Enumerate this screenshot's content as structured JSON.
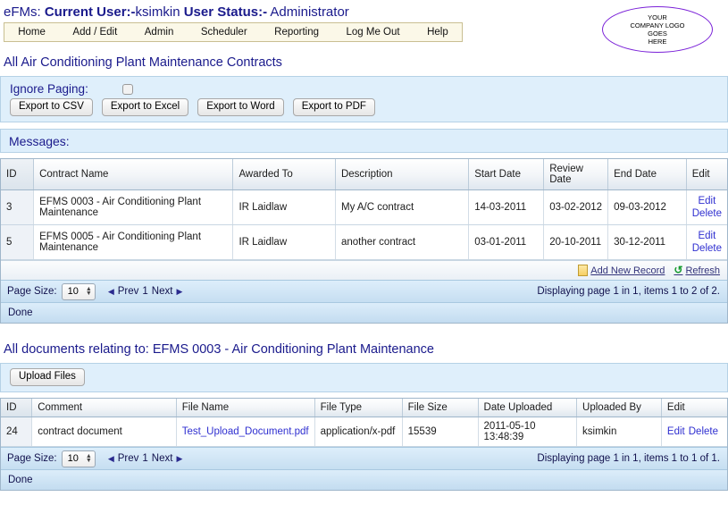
{
  "header": {
    "app_name": "eFMs:",
    "current_user_label": "Current User:-",
    "current_user": "ksimkin",
    "user_status_label": "User Status:-",
    "user_status": "Administrator",
    "nav": [
      {
        "label": "Home"
      },
      {
        "label": "Add / Edit"
      },
      {
        "label": "Admin"
      },
      {
        "label": "Scheduler"
      },
      {
        "label": "Reporting"
      },
      {
        "label": "Log Me Out"
      },
      {
        "label": "Help"
      }
    ],
    "logo": {
      "line1": "YOUR",
      "line2": "COMPANY LOGO",
      "line3": "GOES",
      "line4": "HERE",
      "color": "#7b22d8"
    }
  },
  "contracts_section": {
    "title": "All Air Conditioning Plant Maintenance Contracts",
    "toolbar": {
      "ignore_paging_label": "Ignore Paging:",
      "ignore_paging_checked": false,
      "export_csv": "Export to CSV",
      "export_excel": "Export to Excel",
      "export_word": "Export to Word",
      "export_pdf": "Export to PDF"
    },
    "messages_label": "Messages:",
    "messages_text": "",
    "columns": [
      "ID",
      "Contract Name",
      "Awarded To",
      "Description",
      "Start Date",
      "Review Date",
      "End Date",
      "Edit"
    ],
    "rows": [
      {
        "id": "3",
        "contract_name": "EFMS 0003 - Air Conditioning Plant Maintenance",
        "awarded_to": "IR Laidlaw",
        "description": "My A/C contract",
        "start_date": "14-03-2011",
        "review_date": "03-02-2012",
        "end_date": "09-03-2012",
        "edit": "Edit",
        "delete": "Delete"
      },
      {
        "id": "5",
        "contract_name": "EFMS 0005 - Air Conditioning Plant Maintenance",
        "awarded_to": "IR Laidlaw",
        "description": "another contract",
        "start_date": "03-01-2011",
        "review_date": "20-10-2011",
        "end_date": "30-12-2011",
        "edit": "Edit",
        "delete": "Delete"
      }
    ],
    "actions": {
      "add_new_record": "Add New Record",
      "refresh": "Refresh"
    },
    "pager": {
      "page_size_label": "Page Size:",
      "page_size_value": "10",
      "prev": "Prev",
      "page_number": "1",
      "next": "Next",
      "display_info": "Displaying page 1 in 1, items 1 to 2 of 2."
    },
    "status": "Done"
  },
  "documents_section": {
    "title": "All documents relating to: EFMS 0003 - Air Conditioning Plant Maintenance",
    "upload_button": "Upload Files",
    "columns": [
      "ID",
      "Comment",
      "File Name",
      "File Type",
      "File Size",
      "Date Uploaded",
      "Uploaded By",
      "Edit"
    ],
    "rows": [
      {
        "id": "24",
        "comment": "contract document",
        "file_name": "Test_Upload_Document.pdf",
        "file_type": "application/x-pdf",
        "file_size": "15539",
        "date_uploaded": "2011-05-10 13:48:39",
        "uploaded_by": "ksimkin",
        "edit": "Edit",
        "delete": "Delete"
      }
    ],
    "pager": {
      "page_size_label": "Page Size:",
      "page_size_value": "10",
      "prev": "Prev",
      "page_number": "1",
      "next": "Next",
      "display_info": "Displaying page 1 in 1, items 1 to 1 of 1."
    },
    "status": "Done"
  },
  "theme": {
    "heading_color": "#1a1a8c",
    "link_color": "#2f2fd0",
    "panel_bg": "#ddeefb",
    "nav_bg": "#fbf8e8"
  }
}
